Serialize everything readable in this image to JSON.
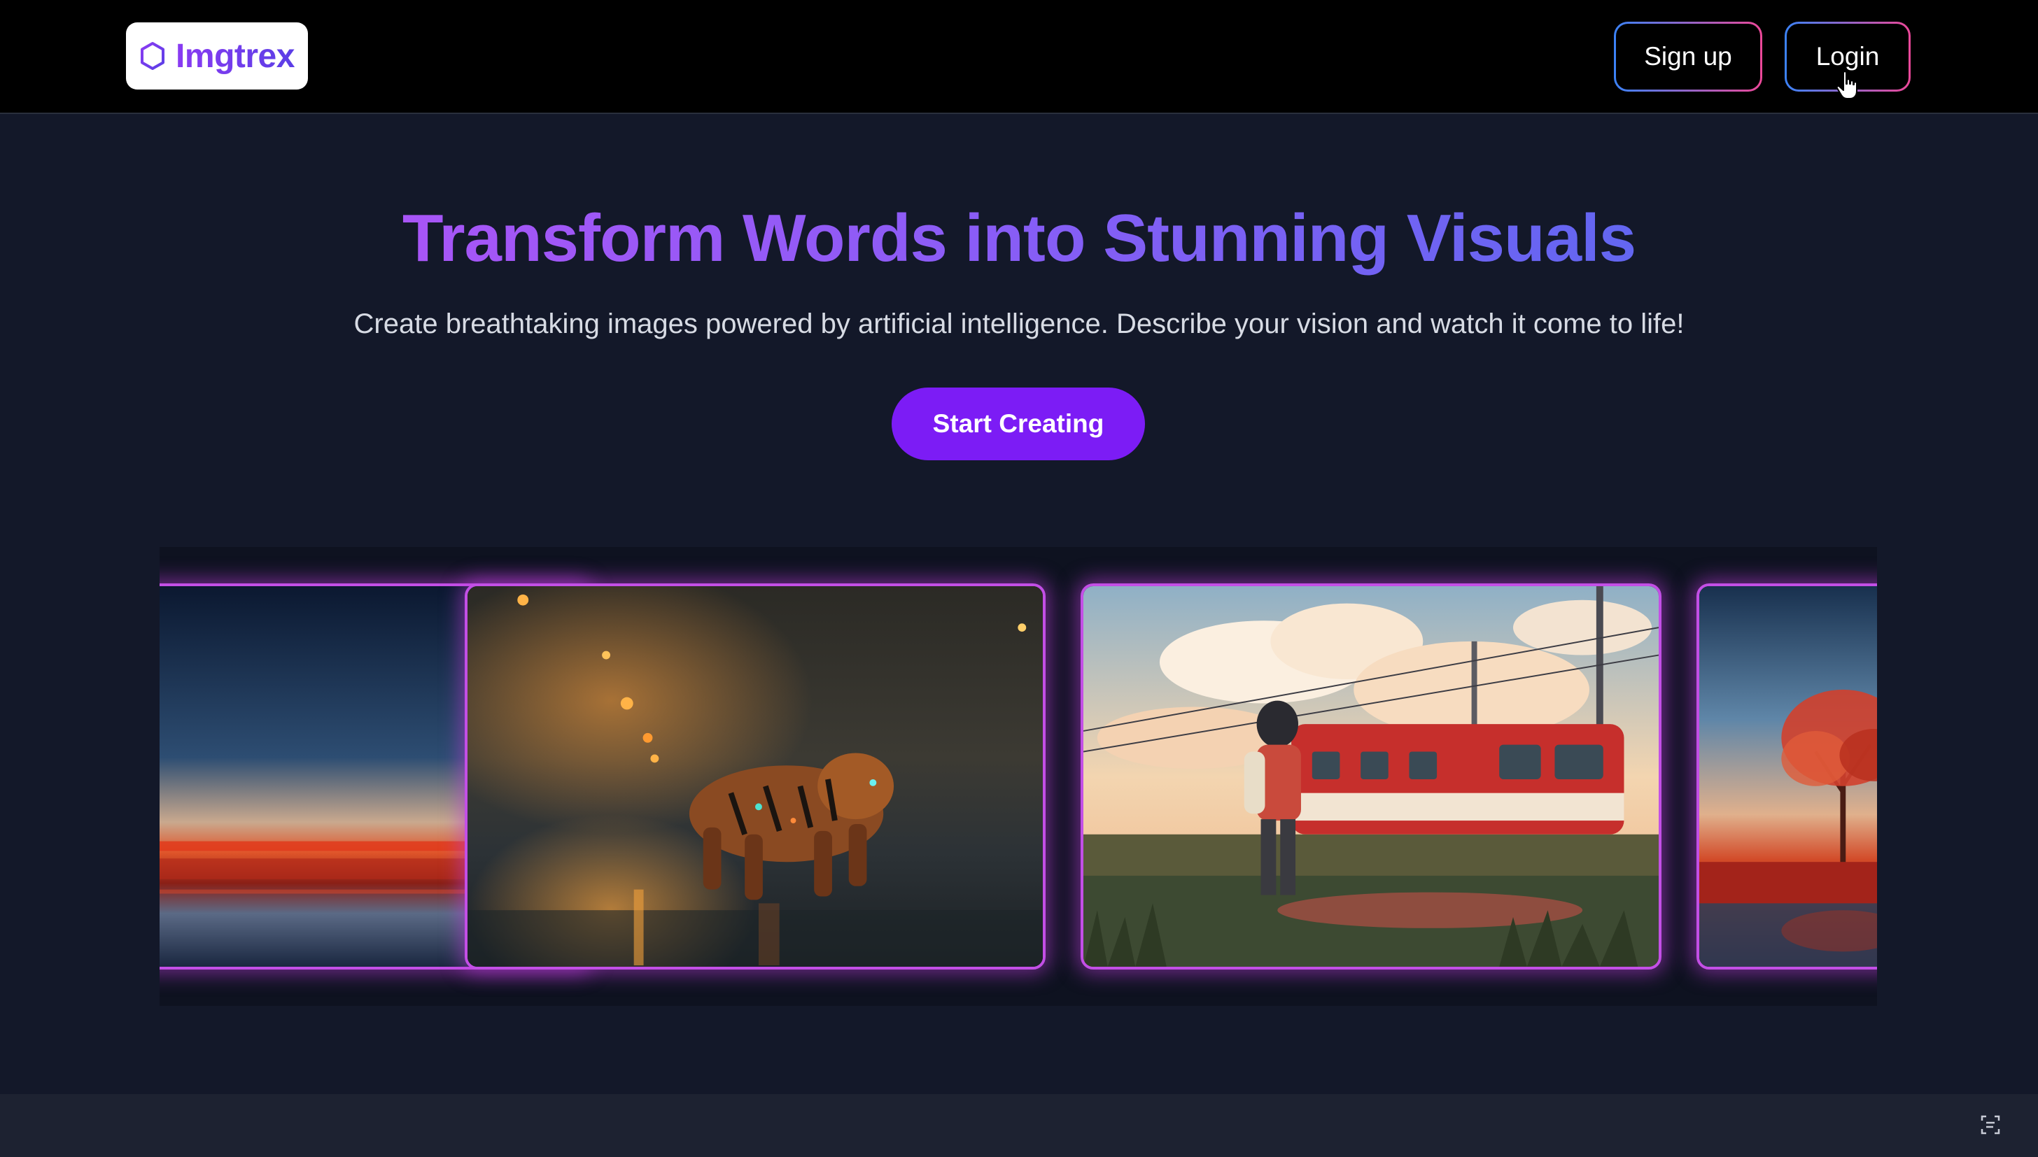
{
  "header": {
    "logo": {
      "text": "Imgtrex",
      "icon": "hexagon-icon"
    },
    "signup_label": "Sign up",
    "login_label": "Login"
  },
  "hero": {
    "title": "Transform Words into Stunning Visuals",
    "subtitle": "Create breathtaking images powered by artificial intelligence. Describe your vision and watch it come to life!",
    "cta_label": "Start Creating"
  },
  "carousel": {
    "slides": [
      {
        "subject": "red-landscape-sunset",
        "partial": true
      },
      {
        "subject": "robotic-tiger-rainy-street"
      },
      {
        "subject": "anime-girl-red-train"
      },
      {
        "subject": "red-tree-sunset-lake",
        "partial": true
      }
    ]
  },
  "colors": {
    "header_bg": "#000000",
    "page_bg": "#131829",
    "accent": "#7c1cf5",
    "title_gradient": [
      "#a855f7",
      "#6366f1"
    ],
    "button_border_gradient": [
      "#3b82f6",
      "#ec4899"
    ],
    "slide_border": "#c34fe6"
  },
  "icons": [
    "hexagon-icon",
    "pointer-cursor-icon",
    "screen-capture-icon"
  ]
}
